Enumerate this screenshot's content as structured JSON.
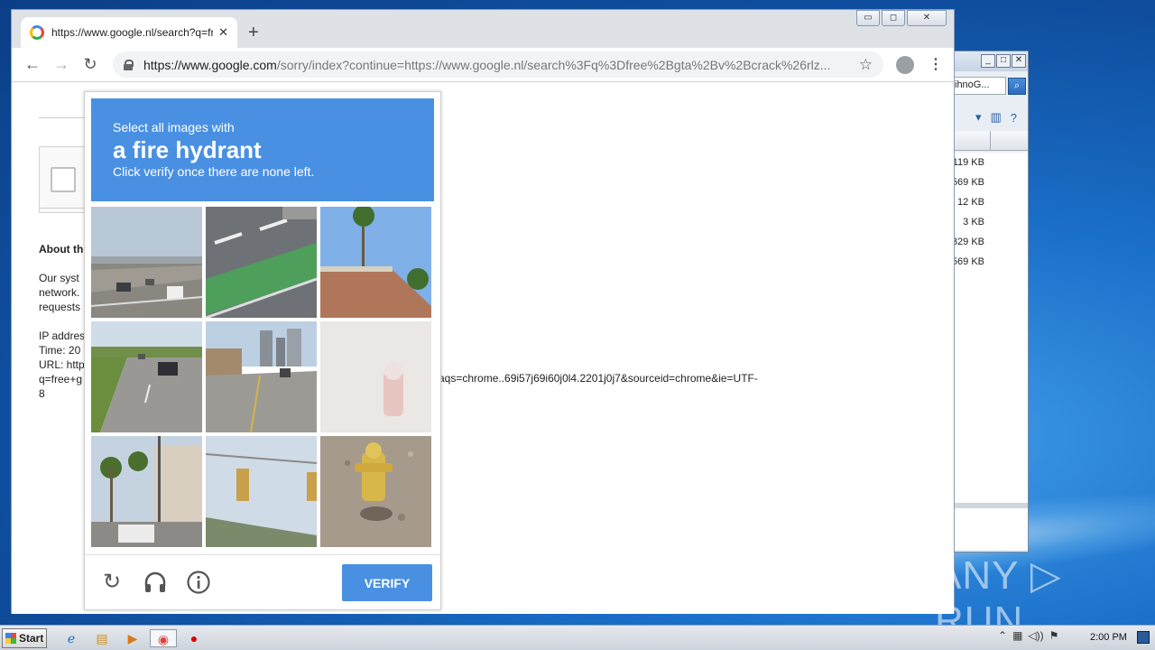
{
  "browser": {
    "tab_title": "https://www.google.nl/search?q=free+gta+v+crack",
    "tab_close": "✕",
    "new_tab": "+",
    "url_host": "https://www.google.com",
    "url_path": "/sorry/index?continue=https://www.google.nl/search%3Fq%3Dfree%2Bgta%2Bv%2Bcrack%26rlz...",
    "window_controls": [
      "▭",
      "◻",
      "✕"
    ]
  },
  "page": {
    "about_heading": "About th",
    "lines1": [
      "Our syst",
      "network.",
      "requests"
    ],
    "lines2": [
      "IP addres",
      "Time: 20",
      "URL: http",
      "q=free+g",
      "8"
    ],
    "url_tail": "aqs=chrome..69i57j69i60j0l4.2201j0j7&sourceid=chrome&ie=UTF-"
  },
  "captcha": {
    "line1": "Select all images with",
    "line2": "a fire hydrant",
    "line3": "Click verify once there are none left.",
    "verify_label": "VERIFY",
    "colors": {
      "header": "#4a90e2"
    }
  },
  "bg_window": {
    "search_text": "ihnoG...",
    "sizes": [
      "119 KB",
      "569 KB",
      "12 KB",
      "3 KB",
      "329 KB",
      "569 KB"
    ]
  },
  "taskbar": {
    "start_label": "Start",
    "clock": "2:00 PM"
  },
  "watermark": "ANY ▷ RUN"
}
